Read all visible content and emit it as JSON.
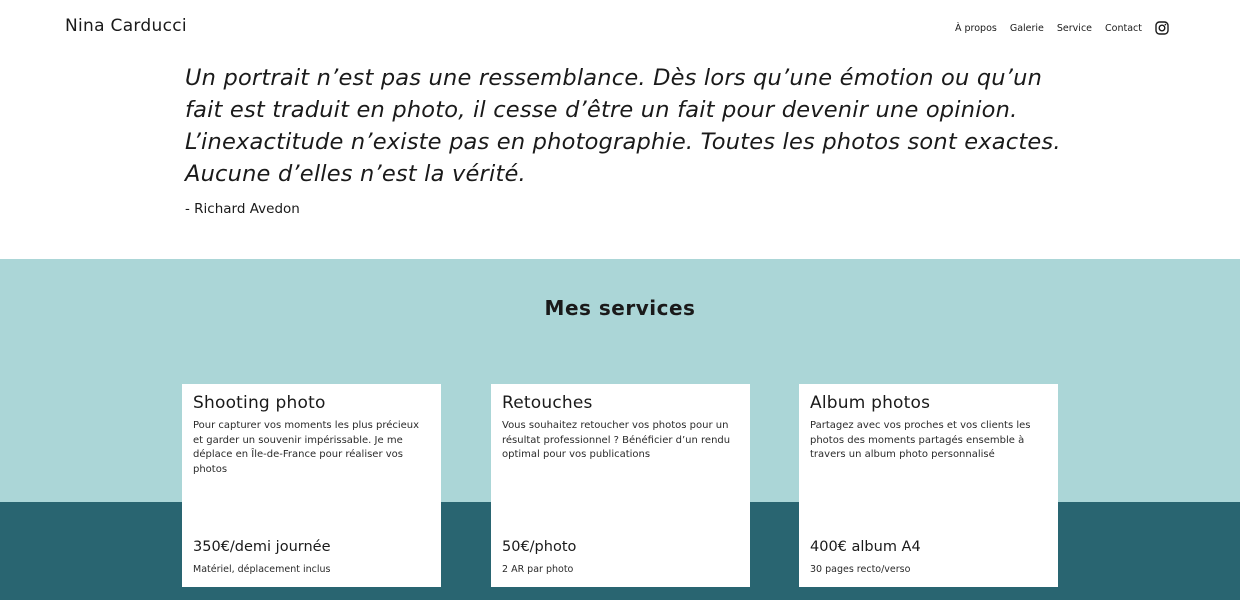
{
  "header": {
    "brand": "Nina Carducci",
    "nav": [
      "À propos",
      "Galerie",
      "Service",
      "Contact"
    ]
  },
  "quote": {
    "text": "Un portrait n’est pas une ressemblance. Dès lors qu’une émotion ou qu’un fait est traduit en photo, il cesse d’être un fait pour devenir une opinion. L’inexactitude n’existe pas en photographie. Toutes les photos sont exactes. Aucune d’elles n’est la vérité.",
    "author": "- Richard Avedon"
  },
  "services": {
    "title": "Mes services",
    "cards": [
      {
        "title": "Shooting photo",
        "description": "Pour capturer vos moments les plus précieux et garder un souvenir impérissable. Je me déplace en Île-de-France pour réaliser vos photos",
        "price": "350€/demi journée",
        "note": "Matériel, déplacement inclus"
      },
      {
        "title": "Retouches",
        "description": "Vous souhaitez retoucher vos photos pour un résultat professionnel ? Bénéficier d’un rendu optimal pour vos publications",
        "price": "50€/photo",
        "note": "2 AR par photo"
      },
      {
        "title": "Album photos",
        "description": "Partagez avec vos proches et vos clients les photos des moments partagés ensemble à travers un album photo personnalisé",
        "price": "400€ album A4",
        "note": "30 pages recto/verso"
      }
    ]
  },
  "colors": {
    "light_teal": "#abd6d7",
    "dark_teal": "#296571"
  },
  "icons": {
    "social": "instagram-icon"
  }
}
